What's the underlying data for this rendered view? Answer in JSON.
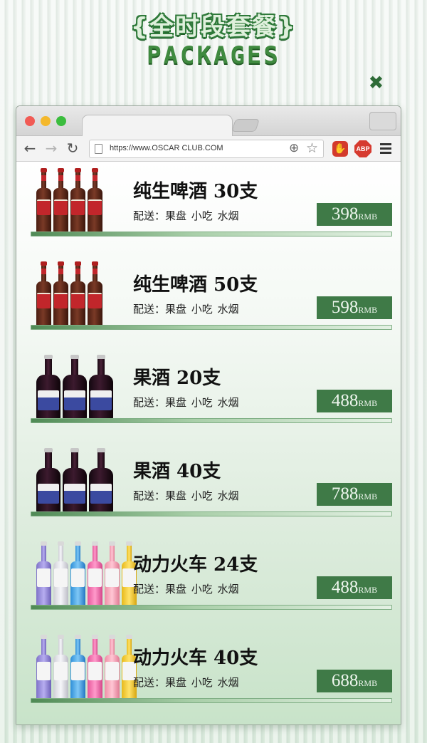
{
  "header": {
    "title_cn": "{全时段套餐}",
    "title_en": "PACKAGES",
    "decor": "✖"
  },
  "browser": {
    "url": "https://www.OSCAR CLUB.COM",
    "icons": {
      "back": "arrow-left-icon",
      "forward": "arrow-right-icon",
      "reload": "reload-icon",
      "zoom": "zoom-icon",
      "star": "star-icon",
      "stop": "stop-hand-icon",
      "abp": "adblock-icon",
      "menu": "hamburger-menu-icon"
    },
    "abp_label": "ABP",
    "traffic_colors": [
      "#f15b55",
      "#f4b82c",
      "#3bbd3e"
    ]
  },
  "theme": {
    "accent": "#3f7a47",
    "price_text": "#eef6ee"
  },
  "packages": [
    {
      "name": "纯生啤酒  30支",
      "includes": "配送：果盘  小吃  水烟",
      "price": "398",
      "unit": "RMB"
    },
    {
      "name": "纯生啤酒  50支",
      "includes": "配送：果盘  小吃  水烟",
      "price": "598",
      "unit": "RMB"
    },
    {
      "name": "果酒  20支",
      "includes": "配送：果盘  小吃  水烟",
      "price": "488",
      "unit": "RMB"
    },
    {
      "name": "果酒  40支",
      "includes": "配送：果盘  小吃  水烟",
      "price": "788",
      "unit": "RMB"
    },
    {
      "name": "动力火车  24支",
      "includes": "配送：果盘  小吃  水烟",
      "price": "488",
      "unit": "RMB"
    },
    {
      "name": "动力火车  40支",
      "includes": "配送：果盘  小吃  水烟",
      "price": "688",
      "unit": "RMB"
    }
  ]
}
